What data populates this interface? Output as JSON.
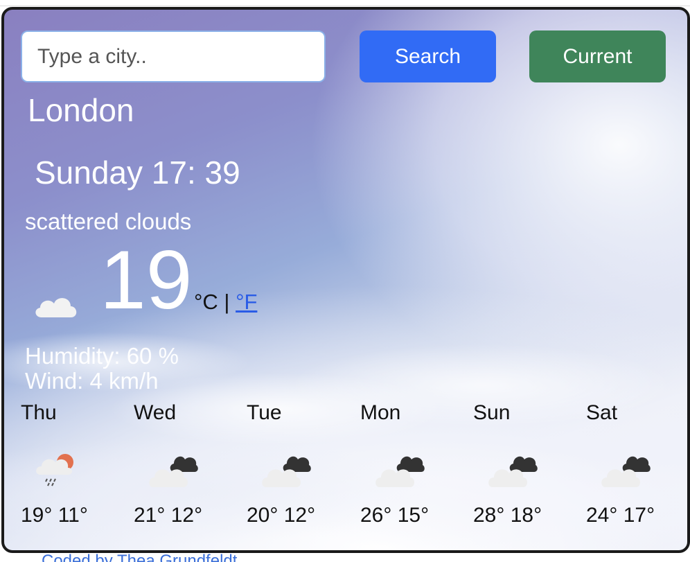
{
  "search": {
    "placeholder": "Type a city..",
    "value": ""
  },
  "buttons": {
    "search_label": "Search",
    "current_label": "Current"
  },
  "colors": {
    "search_button": "#316bf5",
    "current_button": "#3f855a",
    "link": "#2a5ce6"
  },
  "current": {
    "city": "London",
    "datetime": "Sunday 17: 39",
    "description": "scattered clouds",
    "icon": "cloud-icon",
    "temperature": "19",
    "unit_c": "°C",
    "unit_separator": " | ",
    "unit_f": "°F",
    "humidity": "Humidity: 60 %",
    "wind": "Wind: 4 km/h"
  },
  "forecast": [
    {
      "day": "Thu",
      "icon": "rain-sun-cloud-icon",
      "temps": "19° 11°"
    },
    {
      "day": "Wed",
      "icon": "dark-clouds-icon",
      "temps": "21° 12°"
    },
    {
      "day": "Tue",
      "icon": "dark-clouds-icon",
      "temps": "20° 12°"
    },
    {
      "day": "Mon",
      "icon": "dark-clouds-icon",
      "temps": "26° 15°"
    },
    {
      "day": "Sun",
      "icon": "dark-clouds-icon",
      "temps": "28° 18°"
    },
    {
      "day": "Sat",
      "icon": "dark-clouds-icon",
      "temps": "24° 17°"
    }
  ],
  "footer": {
    "text": "Coded by Thea Grundfeldt"
  }
}
